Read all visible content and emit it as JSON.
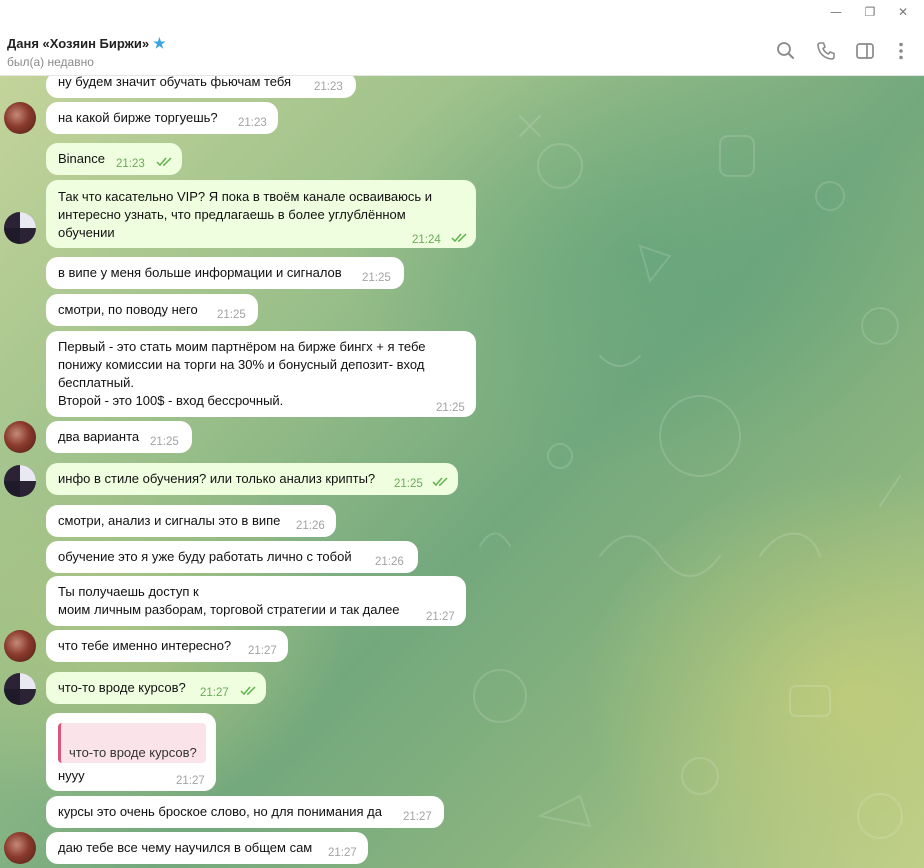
{
  "window": {
    "minimize": "—",
    "restore": "❐",
    "close": "✕"
  },
  "contact": {
    "name": "Даня «Хозяин Биржи»",
    "status": "был(а) недавно"
  },
  "header_icons": [
    "search-icon",
    "call-icon",
    "sidebar-toggle-icon",
    "more-icon"
  ],
  "messages": [
    {
      "dir": "in",
      "text": "ну будем значит обучать фьючам тебя",
      "time": "21:23"
    },
    {
      "dir": "in",
      "text": "на какой бирже торгуешь?",
      "time": "21:23"
    },
    {
      "dir": "out",
      "text": "Binance",
      "time": "21:23",
      "read": true
    },
    {
      "dir": "out",
      "lines": [
        "Так что касательно VIP? Я пока в твоём канале осваиваюсь  и",
        "интересно узнать, что предлагаешь в более углублённом",
        "обучении"
      ],
      "time": "21:24",
      "read": true
    },
    {
      "dir": "in",
      "text": "в випе у меня больше информации и сигналов",
      "time": "21:25"
    },
    {
      "dir": "in",
      "text": "смотри, по поводу него",
      "time": "21:25"
    },
    {
      "dir": "in",
      "lines": [
        "Первый - это стать моим партнёром на бирже бингх + я тебе",
        "понижу комиссии на торги на 30% и бонусный депозит- вход",
        "бесплатный.",
        "Второй - это 100$ - вход бессрочный."
      ],
      "time": "21:25"
    },
    {
      "dir": "in",
      "text": "два варианта",
      "time": "21:25"
    },
    {
      "dir": "out",
      "text": "инфо в стиле обучения? или только анализ крипты?",
      "time": "21:25",
      "read": true
    },
    {
      "dir": "in",
      "text": "смотри, анализ и сигналы это в випе",
      "time": "21:26"
    },
    {
      "dir": "in",
      "text": "обучение это я уже буду работать лично с тобой",
      "time": "21:26"
    },
    {
      "dir": "in",
      "lines": [
        "Ты получаешь доступ к",
        "моим личным разборам, торговой стратегии и так далее"
      ],
      "time": "21:27"
    },
    {
      "dir": "in",
      "text": "что тебе именно интересно?",
      "time": "21:27"
    },
    {
      "dir": "out",
      "text": "что-то вроде курсов?",
      "time": "21:27",
      "read": true
    },
    {
      "dir": "in",
      "quote": "что-то вроде курсов?",
      "text": "нууу",
      "time": "21:27"
    },
    {
      "dir": "in",
      "text": "курсы это очень броское слово, но для понимания да",
      "time": "21:27"
    },
    {
      "dir": "in",
      "text": "даю тебе все чему научился в общем сам",
      "time": "21:27"
    }
  ],
  "colors": {
    "incoming": "#ffffff",
    "outgoing": "#eefedf",
    "time_out": "#6cab5a",
    "star": "#39a3e3",
    "quote_bar": "#d9577a"
  }
}
